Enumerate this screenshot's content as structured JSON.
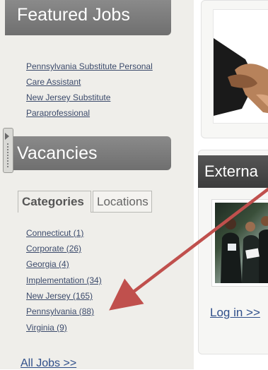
{
  "sidebar": {
    "featured_header": "Featured Jobs",
    "featured_links": [
      "Pennsylvania Substitute Personal",
      "Care Assistant",
      "New Jersey Substitute",
      "Paraprofessional"
    ],
    "vacancies_header": "Vacancies",
    "tabs": {
      "categories": "Categories",
      "locations": "Locations"
    },
    "categories": [
      "Connecticut (1)",
      "Corporate (26)",
      "Georgia (4)",
      "Implementation (34)",
      "New Jersey (165)",
      "Pennsylvania (88)",
      "Virginia (9)"
    ],
    "all_jobs": "All Jobs >>"
  },
  "main": {
    "external_header": "Externa",
    "login_link": "Log in >>"
  },
  "annotation": {
    "arrow_color": "#c0504d"
  },
  "colors": {
    "header_gray": "#777777",
    "sidebar_bg": "#efeeea",
    "link": "#3b4a6b"
  }
}
